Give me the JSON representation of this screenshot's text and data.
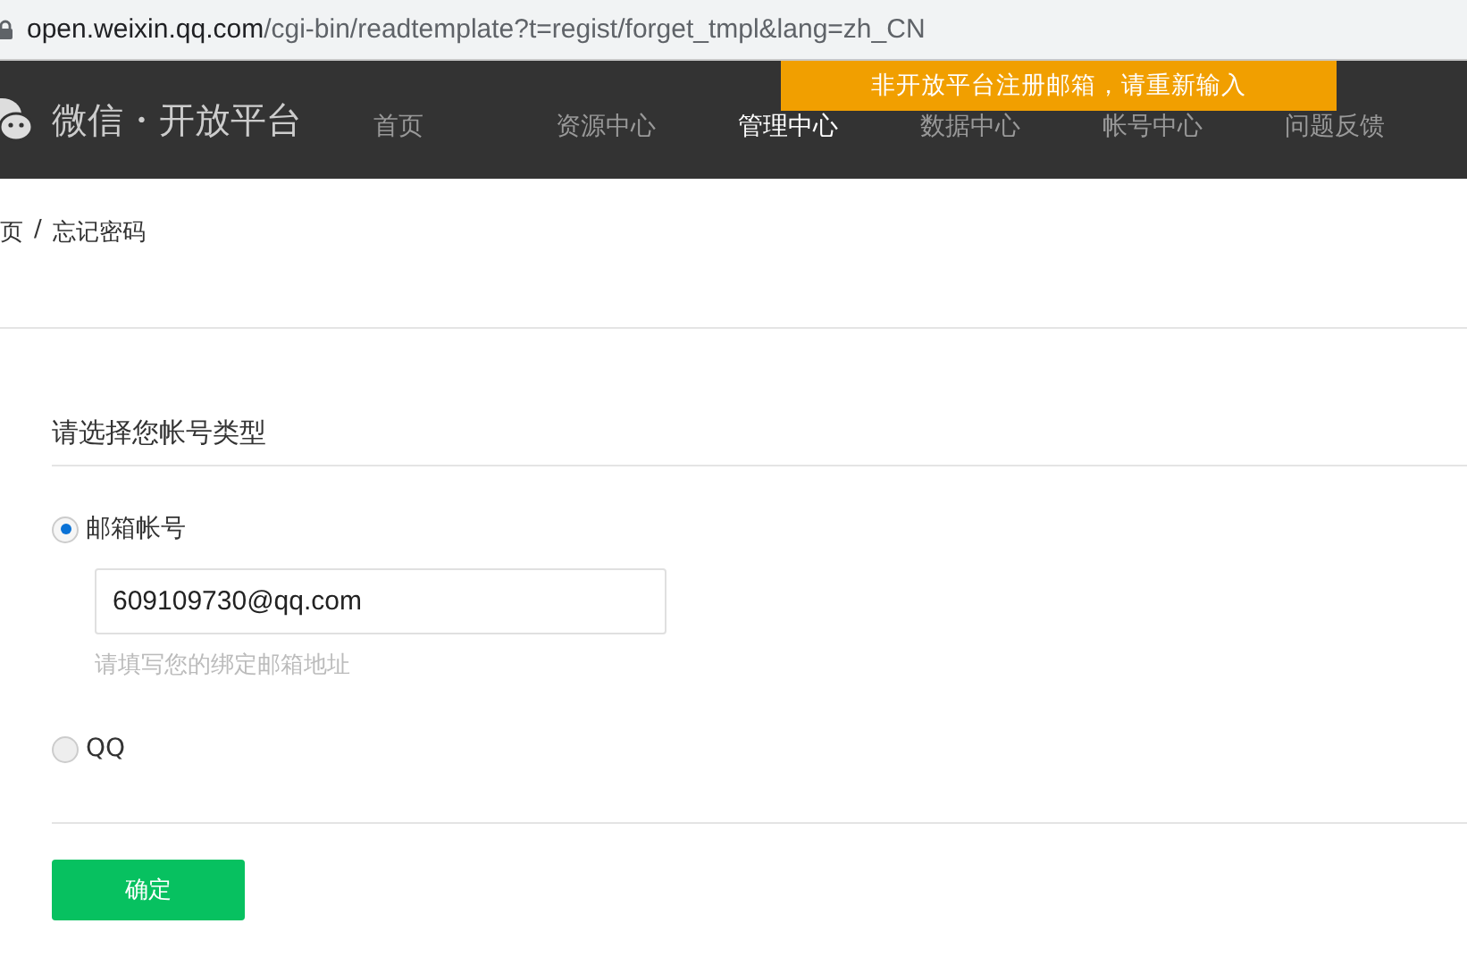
{
  "address_bar": {
    "host": "open.weixin.qq.com",
    "path": "/cgi-bin/readtemplate?t=regist/forget_tmpl&lang=zh_CN"
  },
  "header": {
    "logo_text": "微信・开放平台",
    "nav": [
      {
        "label": "首页",
        "selected": false
      },
      {
        "label": "资源中心",
        "selected": false
      },
      {
        "label": "管理中心",
        "selected": true
      },
      {
        "label": "数据中心",
        "selected": false
      },
      {
        "label": "帐号中心",
        "selected": false
      },
      {
        "label": "问题反馈",
        "selected": false
      }
    ]
  },
  "toast": "非开放平台注册邮箱，请重新输入",
  "breadcrumb": {
    "parent": "页",
    "separator": "/",
    "current": "忘记密码"
  },
  "form": {
    "title": "请选择您帐号类型",
    "options": [
      {
        "label": "邮箱帐号",
        "selected": true,
        "field": {
          "value": "609109730@qq.com",
          "hint": "请填写您的绑定邮箱地址"
        }
      },
      {
        "label": "QQ",
        "selected": false
      }
    ],
    "submit": "确定"
  }
}
